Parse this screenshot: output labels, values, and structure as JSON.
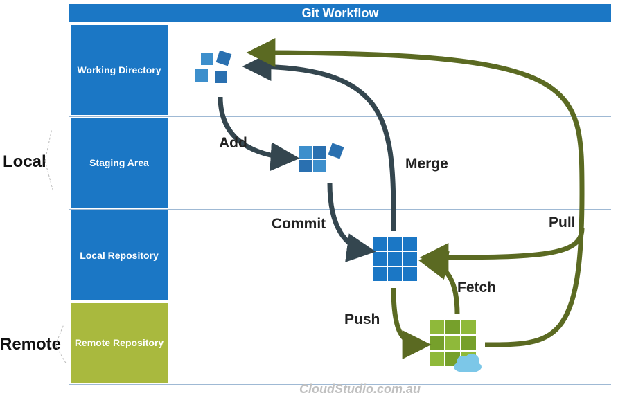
{
  "title": "Git Workflow",
  "scope": {
    "local": "Local",
    "remote": "Remote"
  },
  "rows": {
    "working_directory": "Working Directory",
    "staging_area": "Staging Area",
    "local_repository": "Local Repository",
    "remote_repository": "Remote Repository"
  },
  "ops": {
    "add": "Add",
    "commit": "Commit",
    "push": "Push",
    "merge": "Merge",
    "fetch": "Fetch",
    "pull": "Pull"
  },
  "credit": "CloudStudio.com.au",
  "colors": {
    "brand_blue": "#1b77c5",
    "olive_green": "#a9b93e",
    "arrow_dark": "#34464f",
    "arrow_olive": "#5b6a22",
    "box_blue1": "#3d8fcc",
    "box_blue2": "#2a70b0",
    "box_blue3": "#1b5fa9",
    "box_green1": "#8fb93a",
    "box_green2": "#76a02b",
    "cloud": "#7cc7e8"
  }
}
